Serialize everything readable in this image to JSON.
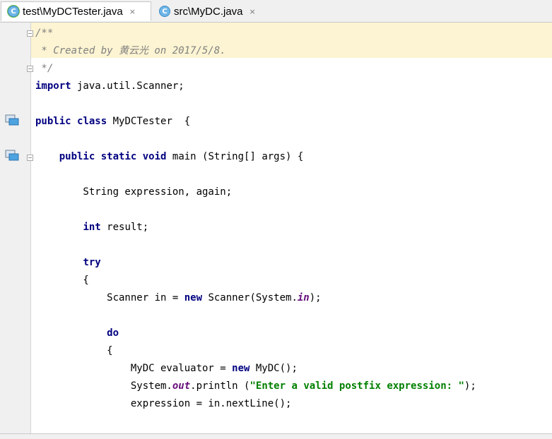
{
  "tabs": [
    {
      "label": "test\\MyDCTester.java",
      "active": true,
      "icon": "java-class-icon",
      "close": "×"
    },
    {
      "label": "src\\MyDC.java",
      "active": false,
      "icon": "java-class-icon",
      "close": "×"
    }
  ],
  "tab_icon_letter": "C",
  "colors": {
    "keyword": "#000080",
    "comment": "#808080",
    "string": "#008000",
    "static_field": "#660e7a",
    "doc_highlight": "#fcf4d2",
    "gutter": "#f0f0f0"
  },
  "code": {
    "l1": {
      "t1": "/**"
    },
    "l2": {
      "t1": " * Created by 黄云光 on 2017/5/8."
    },
    "l3": {
      "t1": " */"
    },
    "l4": {
      "t1": "import",
      "t2": " java.util.Scanner;"
    },
    "l5": {
      "t1": "public",
      "t2": " ",
      "t3": "class",
      "t4": " MyDCTester  {"
    },
    "l6": {
      "t1": "    ",
      "t2": "public",
      "t3": " ",
      "t4": "static",
      "t5": " ",
      "t6": "void",
      "t7": " main (String[] args) {"
    },
    "l7": {
      "t1": "        String expression, again;"
    },
    "l8": {
      "t1": "        ",
      "t2": "int",
      "t3": " result;"
    },
    "l9": {
      "t1": "        ",
      "t2": "try"
    },
    "l10": {
      "t1": "        {"
    },
    "l11": {
      "t1": "            Scanner in = ",
      "t2": "new",
      "t3": " Scanner(System.",
      "t4": "in",
      "t5": ");"
    },
    "l12": {
      "t1": "            ",
      "t2": "do"
    },
    "l13": {
      "t1": "            {"
    },
    "l14": {
      "t1": "                MyDC evaluator = ",
      "t2": "new",
      "t3": " MyDC();"
    },
    "l15": {
      "t1": "                System.",
      "t2": "out",
      "t3": ".println (",
      "t4": "\"Enter a valid postfix expression: \"",
      "t5": ");"
    },
    "l16": {
      "t1": "                expression = in.nextLine();"
    }
  }
}
